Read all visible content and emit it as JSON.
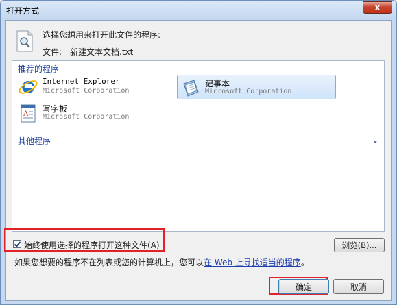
{
  "window": {
    "title": "打开方式",
    "close_glyph": "x"
  },
  "header": {
    "prompt": "选择您想用来打开此文件的程序:",
    "file_label": "文件:",
    "file_name": "新建文本文档.txt"
  },
  "groups": {
    "recommended": "推荐的程序",
    "other": "其他程序"
  },
  "programs": [
    {
      "name": "Internet Explorer",
      "company": "Microsoft Corporation",
      "icon": "internet-explorer-icon",
      "selected": false
    },
    {
      "name": "记事本",
      "company": "Microsoft Corporation",
      "icon": "notepad-icon",
      "selected": true
    },
    {
      "name": "写字板",
      "company": "Microsoft Corporation",
      "icon": "wordpad-icon",
      "selected": false
    }
  ],
  "options": {
    "always_use_label": "始终使用选择的程序打开这种文件(A)",
    "always_use_checked": true
  },
  "browse_label": "浏览(B)...",
  "footer": {
    "prefix": "如果您想要的程序不在列表或您的计算机上，您可以",
    "link": "在 Web 上寻找适当的程序",
    "suffix": "。"
  },
  "buttons": {
    "ok": "确定",
    "cancel": "取消"
  },
  "colors": {
    "accent": "#1e3f9e",
    "highlight": "#e0212a",
    "selection": "#cfe3fa"
  }
}
